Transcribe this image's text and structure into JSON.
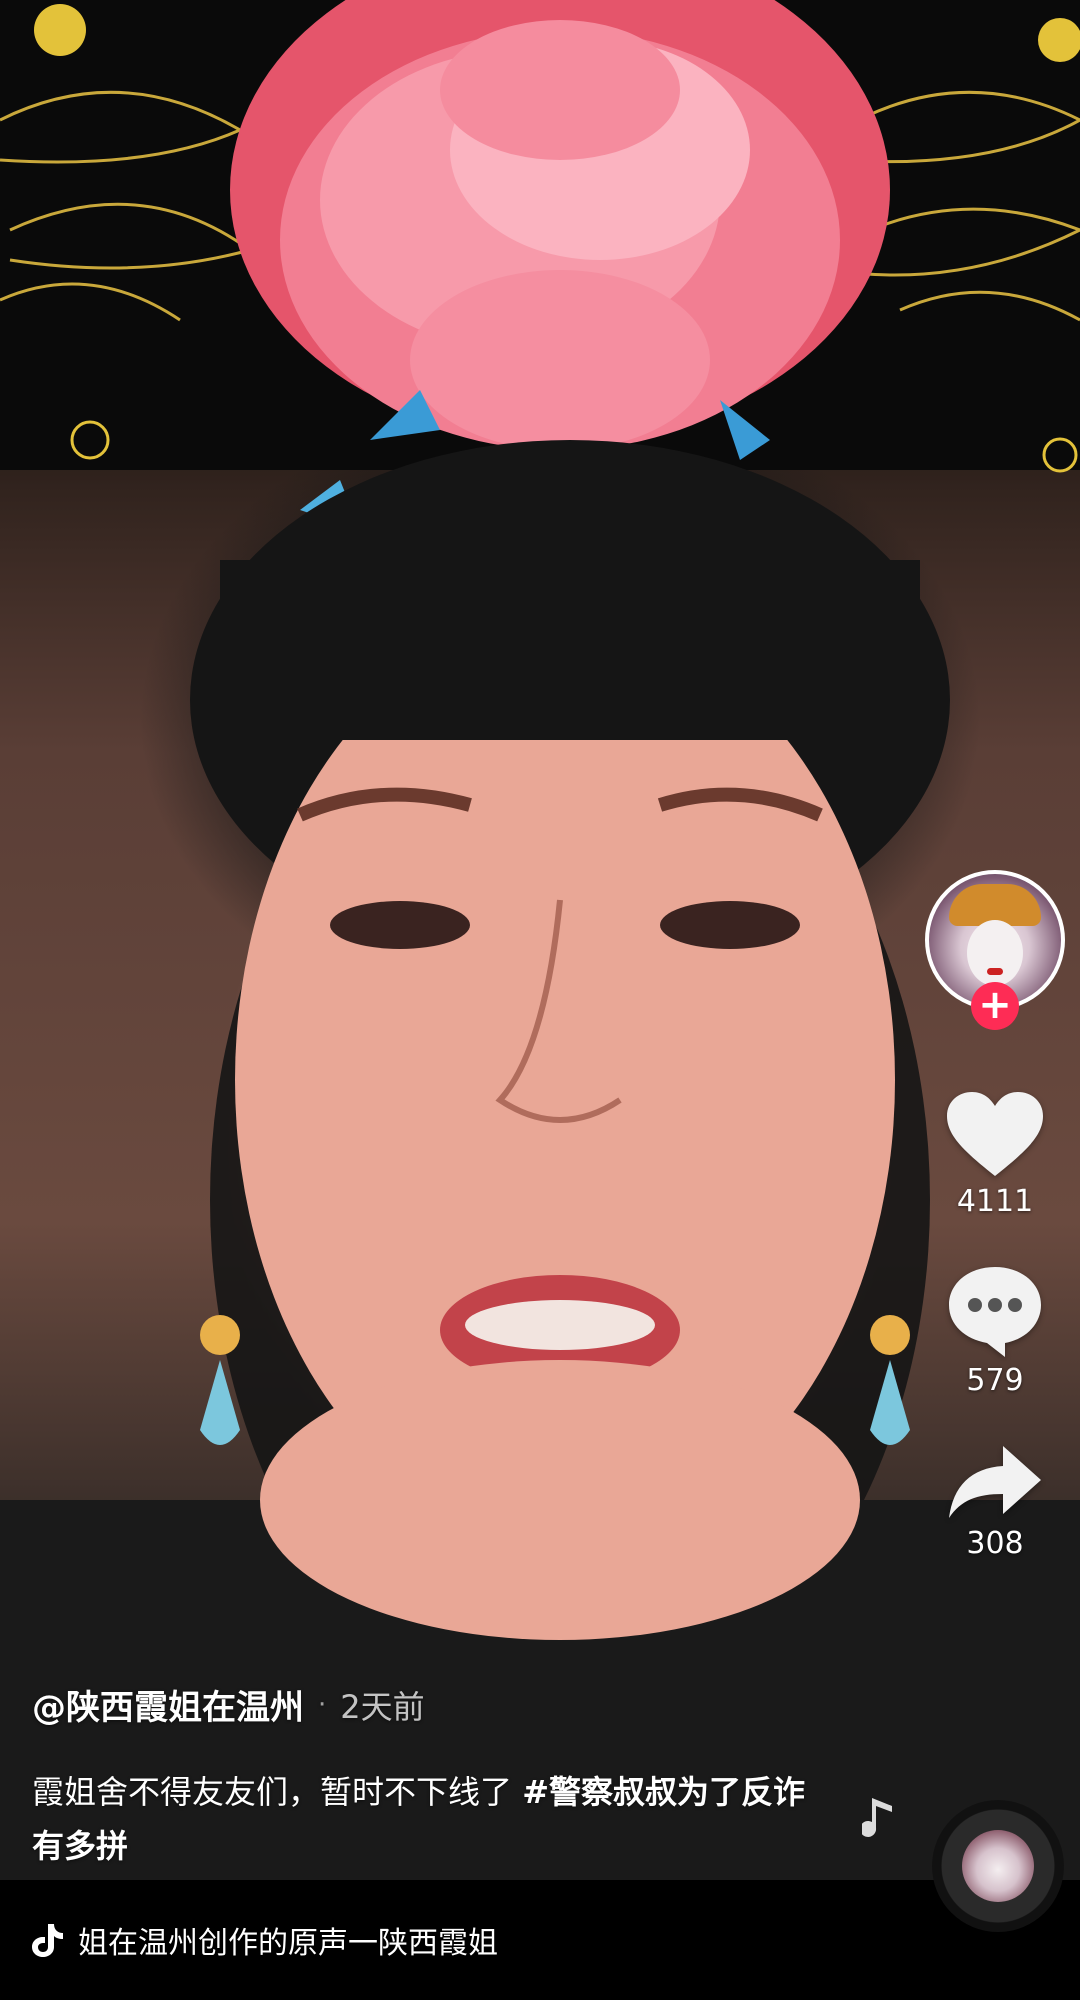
{
  "author": {
    "handle": "@陕西霞姐在温州",
    "time": "2天前",
    "separator": "·"
  },
  "description": {
    "text": "霞姐舍不得友友们，暂时不下线了 ",
    "hashtag": "#警察叔叔为了反诈有多拼"
  },
  "actions": {
    "follow_symbol": "+",
    "like_count": "4111",
    "comment_count": "579",
    "share_count": "308"
  },
  "music": {
    "text": "姐在温州创作的原声一陕西霞姐"
  },
  "colors": {
    "follow": "#fe2c55",
    "background": "#000000"
  },
  "icons": [
    "heart-icon",
    "comment-icon",
    "share-icon",
    "tiktok-icon",
    "music-note-icon",
    "plus-icon"
  ]
}
